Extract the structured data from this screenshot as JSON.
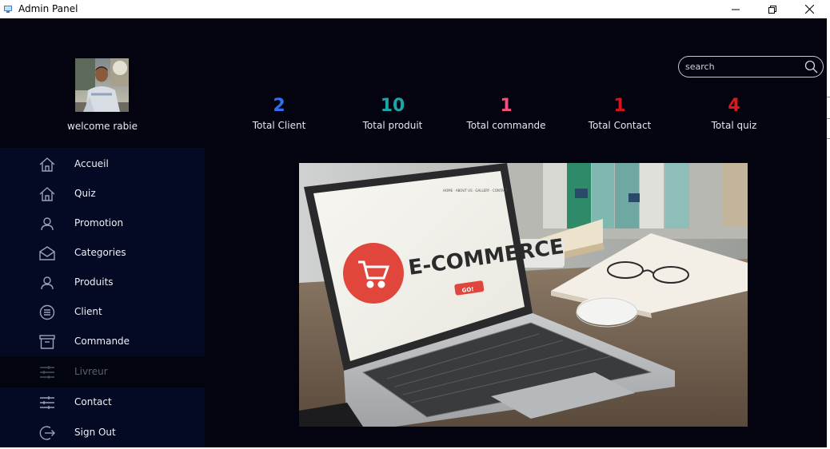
{
  "window": {
    "title": "Admin Panel"
  },
  "user": {
    "welcome": "welcome rabie"
  },
  "search": {
    "placeholder": "search"
  },
  "stats": [
    {
      "value": "2",
      "label": "Total Client",
      "color": "#2f6ff0"
    },
    {
      "value": "10",
      "label": "Total produit",
      "color": "#1aa7a8"
    },
    {
      "value": "1",
      "label": "Total commande",
      "color": "#f0507a"
    },
    {
      "value": "1",
      "label": "Total Contact",
      "color": "#d4141a"
    },
    {
      "value": "4",
      "label": "Total quiz",
      "color": "#e01818"
    }
  ],
  "sidebar": {
    "items": [
      {
        "label": "Accueil",
        "icon": "home-icon"
      },
      {
        "label": "Quiz",
        "icon": "home-icon"
      },
      {
        "label": "Promotion",
        "icon": "user-icon"
      },
      {
        "label": "Categories",
        "icon": "envelope-icon"
      },
      {
        "label": "Produits",
        "icon": "user-icon"
      },
      {
        "label": "Client",
        "icon": "list-circle-icon"
      },
      {
        "label": "Commande",
        "icon": "archive-icon"
      },
      {
        "label": "Livreur",
        "icon": "sliders-icon",
        "disabled": true
      },
      {
        "label": "Contact",
        "icon": "sliders-icon"
      },
      {
        "label": "Sign Out",
        "icon": "sign-out-icon"
      }
    ]
  },
  "hero": {
    "screen_heading": "E-COMMERCE",
    "screen_button": "GO!",
    "screen_nav": "HOME · ABOUT US · GALLERY · CONTACT"
  },
  "colors": {
    "background": "#03040f",
    "sidebar": "#050a24",
    "text": "#e8e8ee",
    "cart_circle": "#e0463c"
  }
}
